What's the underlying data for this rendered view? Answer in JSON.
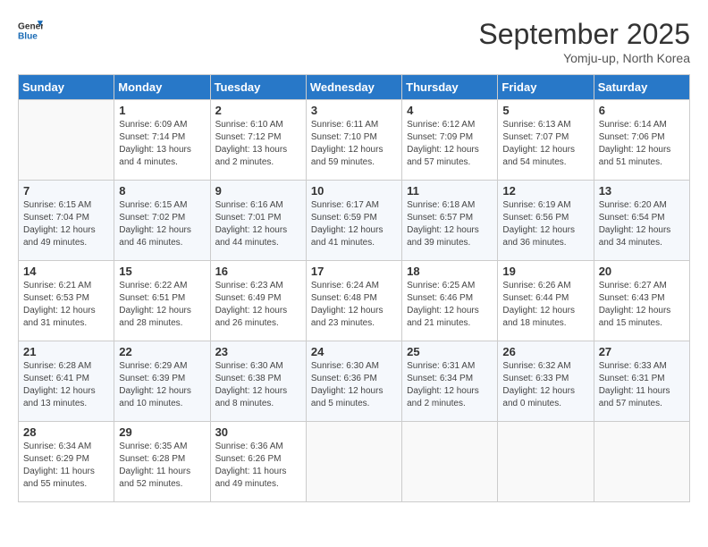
{
  "header": {
    "logo_line1": "General",
    "logo_line2": "Blue",
    "month_title": "September 2025",
    "location": "Yomju-up, North Korea"
  },
  "weekdays": [
    "Sunday",
    "Monday",
    "Tuesday",
    "Wednesday",
    "Thursday",
    "Friday",
    "Saturday"
  ],
  "weeks": [
    [
      {
        "day": "",
        "sunrise": "",
        "sunset": "",
        "daylight": ""
      },
      {
        "day": "1",
        "sunrise": "Sunrise: 6:09 AM",
        "sunset": "Sunset: 7:14 PM",
        "daylight": "Daylight: 13 hours and 4 minutes."
      },
      {
        "day": "2",
        "sunrise": "Sunrise: 6:10 AM",
        "sunset": "Sunset: 7:12 PM",
        "daylight": "Daylight: 13 hours and 2 minutes."
      },
      {
        "day": "3",
        "sunrise": "Sunrise: 6:11 AM",
        "sunset": "Sunset: 7:10 PM",
        "daylight": "Daylight: 12 hours and 59 minutes."
      },
      {
        "day": "4",
        "sunrise": "Sunrise: 6:12 AM",
        "sunset": "Sunset: 7:09 PM",
        "daylight": "Daylight: 12 hours and 57 minutes."
      },
      {
        "day": "5",
        "sunrise": "Sunrise: 6:13 AM",
        "sunset": "Sunset: 7:07 PM",
        "daylight": "Daylight: 12 hours and 54 minutes."
      },
      {
        "day": "6",
        "sunrise": "Sunrise: 6:14 AM",
        "sunset": "Sunset: 7:06 PM",
        "daylight": "Daylight: 12 hours and 51 minutes."
      }
    ],
    [
      {
        "day": "7",
        "sunrise": "Sunrise: 6:15 AM",
        "sunset": "Sunset: 7:04 PM",
        "daylight": "Daylight: 12 hours and 49 minutes."
      },
      {
        "day": "8",
        "sunrise": "Sunrise: 6:15 AM",
        "sunset": "Sunset: 7:02 PM",
        "daylight": "Daylight: 12 hours and 46 minutes."
      },
      {
        "day": "9",
        "sunrise": "Sunrise: 6:16 AM",
        "sunset": "Sunset: 7:01 PM",
        "daylight": "Daylight: 12 hours and 44 minutes."
      },
      {
        "day": "10",
        "sunrise": "Sunrise: 6:17 AM",
        "sunset": "Sunset: 6:59 PM",
        "daylight": "Daylight: 12 hours and 41 minutes."
      },
      {
        "day": "11",
        "sunrise": "Sunrise: 6:18 AM",
        "sunset": "Sunset: 6:57 PM",
        "daylight": "Daylight: 12 hours and 39 minutes."
      },
      {
        "day": "12",
        "sunrise": "Sunrise: 6:19 AM",
        "sunset": "Sunset: 6:56 PM",
        "daylight": "Daylight: 12 hours and 36 minutes."
      },
      {
        "day": "13",
        "sunrise": "Sunrise: 6:20 AM",
        "sunset": "Sunset: 6:54 PM",
        "daylight": "Daylight: 12 hours and 34 minutes."
      }
    ],
    [
      {
        "day": "14",
        "sunrise": "Sunrise: 6:21 AM",
        "sunset": "Sunset: 6:53 PM",
        "daylight": "Daylight: 12 hours and 31 minutes."
      },
      {
        "day": "15",
        "sunrise": "Sunrise: 6:22 AM",
        "sunset": "Sunset: 6:51 PM",
        "daylight": "Daylight: 12 hours and 28 minutes."
      },
      {
        "day": "16",
        "sunrise": "Sunrise: 6:23 AM",
        "sunset": "Sunset: 6:49 PM",
        "daylight": "Daylight: 12 hours and 26 minutes."
      },
      {
        "day": "17",
        "sunrise": "Sunrise: 6:24 AM",
        "sunset": "Sunset: 6:48 PM",
        "daylight": "Daylight: 12 hours and 23 minutes."
      },
      {
        "day": "18",
        "sunrise": "Sunrise: 6:25 AM",
        "sunset": "Sunset: 6:46 PM",
        "daylight": "Daylight: 12 hours and 21 minutes."
      },
      {
        "day": "19",
        "sunrise": "Sunrise: 6:26 AM",
        "sunset": "Sunset: 6:44 PM",
        "daylight": "Daylight: 12 hours and 18 minutes."
      },
      {
        "day": "20",
        "sunrise": "Sunrise: 6:27 AM",
        "sunset": "Sunset: 6:43 PM",
        "daylight": "Daylight: 12 hours and 15 minutes."
      }
    ],
    [
      {
        "day": "21",
        "sunrise": "Sunrise: 6:28 AM",
        "sunset": "Sunset: 6:41 PM",
        "daylight": "Daylight: 12 hours and 13 minutes."
      },
      {
        "day": "22",
        "sunrise": "Sunrise: 6:29 AM",
        "sunset": "Sunset: 6:39 PM",
        "daylight": "Daylight: 12 hours and 10 minutes."
      },
      {
        "day": "23",
        "sunrise": "Sunrise: 6:30 AM",
        "sunset": "Sunset: 6:38 PM",
        "daylight": "Daylight: 12 hours and 8 minutes."
      },
      {
        "day": "24",
        "sunrise": "Sunrise: 6:30 AM",
        "sunset": "Sunset: 6:36 PM",
        "daylight": "Daylight: 12 hours and 5 minutes."
      },
      {
        "day": "25",
        "sunrise": "Sunrise: 6:31 AM",
        "sunset": "Sunset: 6:34 PM",
        "daylight": "Daylight: 12 hours and 2 minutes."
      },
      {
        "day": "26",
        "sunrise": "Sunrise: 6:32 AM",
        "sunset": "Sunset: 6:33 PM",
        "daylight": "Daylight: 12 hours and 0 minutes."
      },
      {
        "day": "27",
        "sunrise": "Sunrise: 6:33 AM",
        "sunset": "Sunset: 6:31 PM",
        "daylight": "Daylight: 11 hours and 57 minutes."
      }
    ],
    [
      {
        "day": "28",
        "sunrise": "Sunrise: 6:34 AM",
        "sunset": "Sunset: 6:29 PM",
        "daylight": "Daylight: 11 hours and 55 minutes."
      },
      {
        "day": "29",
        "sunrise": "Sunrise: 6:35 AM",
        "sunset": "Sunset: 6:28 PM",
        "daylight": "Daylight: 11 hours and 52 minutes."
      },
      {
        "day": "30",
        "sunrise": "Sunrise: 6:36 AM",
        "sunset": "Sunset: 6:26 PM",
        "daylight": "Daylight: 11 hours and 49 minutes."
      },
      {
        "day": "",
        "sunrise": "",
        "sunset": "",
        "daylight": ""
      },
      {
        "day": "",
        "sunrise": "",
        "sunset": "",
        "daylight": ""
      },
      {
        "day": "",
        "sunrise": "",
        "sunset": "",
        "daylight": ""
      },
      {
        "day": "",
        "sunrise": "",
        "sunset": "",
        "daylight": ""
      }
    ]
  ]
}
